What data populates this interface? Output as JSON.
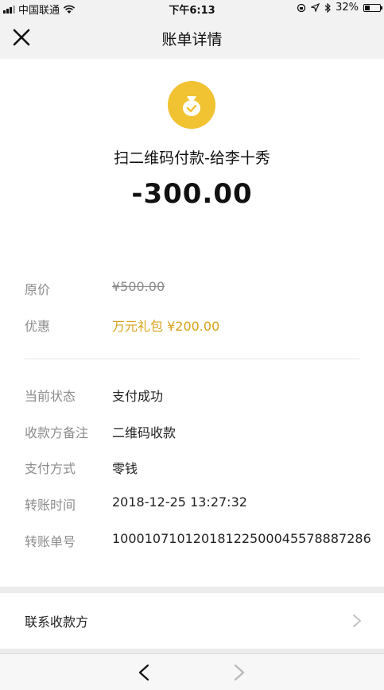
{
  "status_bar": {
    "carrier": "中国联通",
    "time": "下午6:13",
    "battery": "32%",
    "battery_level": 0.32
  },
  "header": {
    "title": "账单详情"
  },
  "transaction": {
    "title": "扫二维码付款-给李十秀",
    "amount": "-300.00"
  },
  "details": {
    "original_price_label": "原价",
    "original_price_value": "¥500.00",
    "discount_label": "优惠",
    "discount_value": "万元礼包 ¥200.00",
    "status_label": "当前状态",
    "status_value": "支付成功",
    "note_label": "收款方备注",
    "note_value": "二维码收款",
    "method_label": "支付方式",
    "method_value": "零钱",
    "time_label": "转账时间",
    "time_value": "2018-12-25 13:27:32",
    "order_label": "转账单号",
    "order_value": "1000107101201812250004557888728‌6"
  },
  "contact": {
    "label": "联系收款方"
  },
  "colors": {
    "accent_gold": "#d9a21b",
    "icon_yellow": "#f1c232"
  }
}
